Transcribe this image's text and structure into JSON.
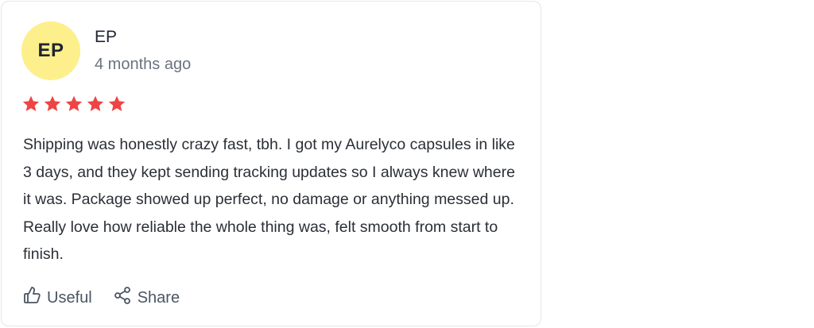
{
  "review": {
    "avatar_initials": "EP",
    "avatar_color": "#fdef8c",
    "author": "EP",
    "date": "4 months ago",
    "rating": 5,
    "rating_max": 5,
    "star_color": "#ef4444",
    "body": "Shipping was honestly crazy fast, tbh. I got my Aurelyco capsules in like 3 days, and they kept sending tracking updates so I always knew where it was. Package showed up perfect, no damage or anything messed up. Really love how reliable the whole thing was, felt smooth from start to finish."
  },
  "actions": {
    "useful": {
      "label": "Useful",
      "icon": "thumbs-up-icon"
    },
    "share": {
      "label": "Share",
      "icon": "share-icon"
    }
  }
}
